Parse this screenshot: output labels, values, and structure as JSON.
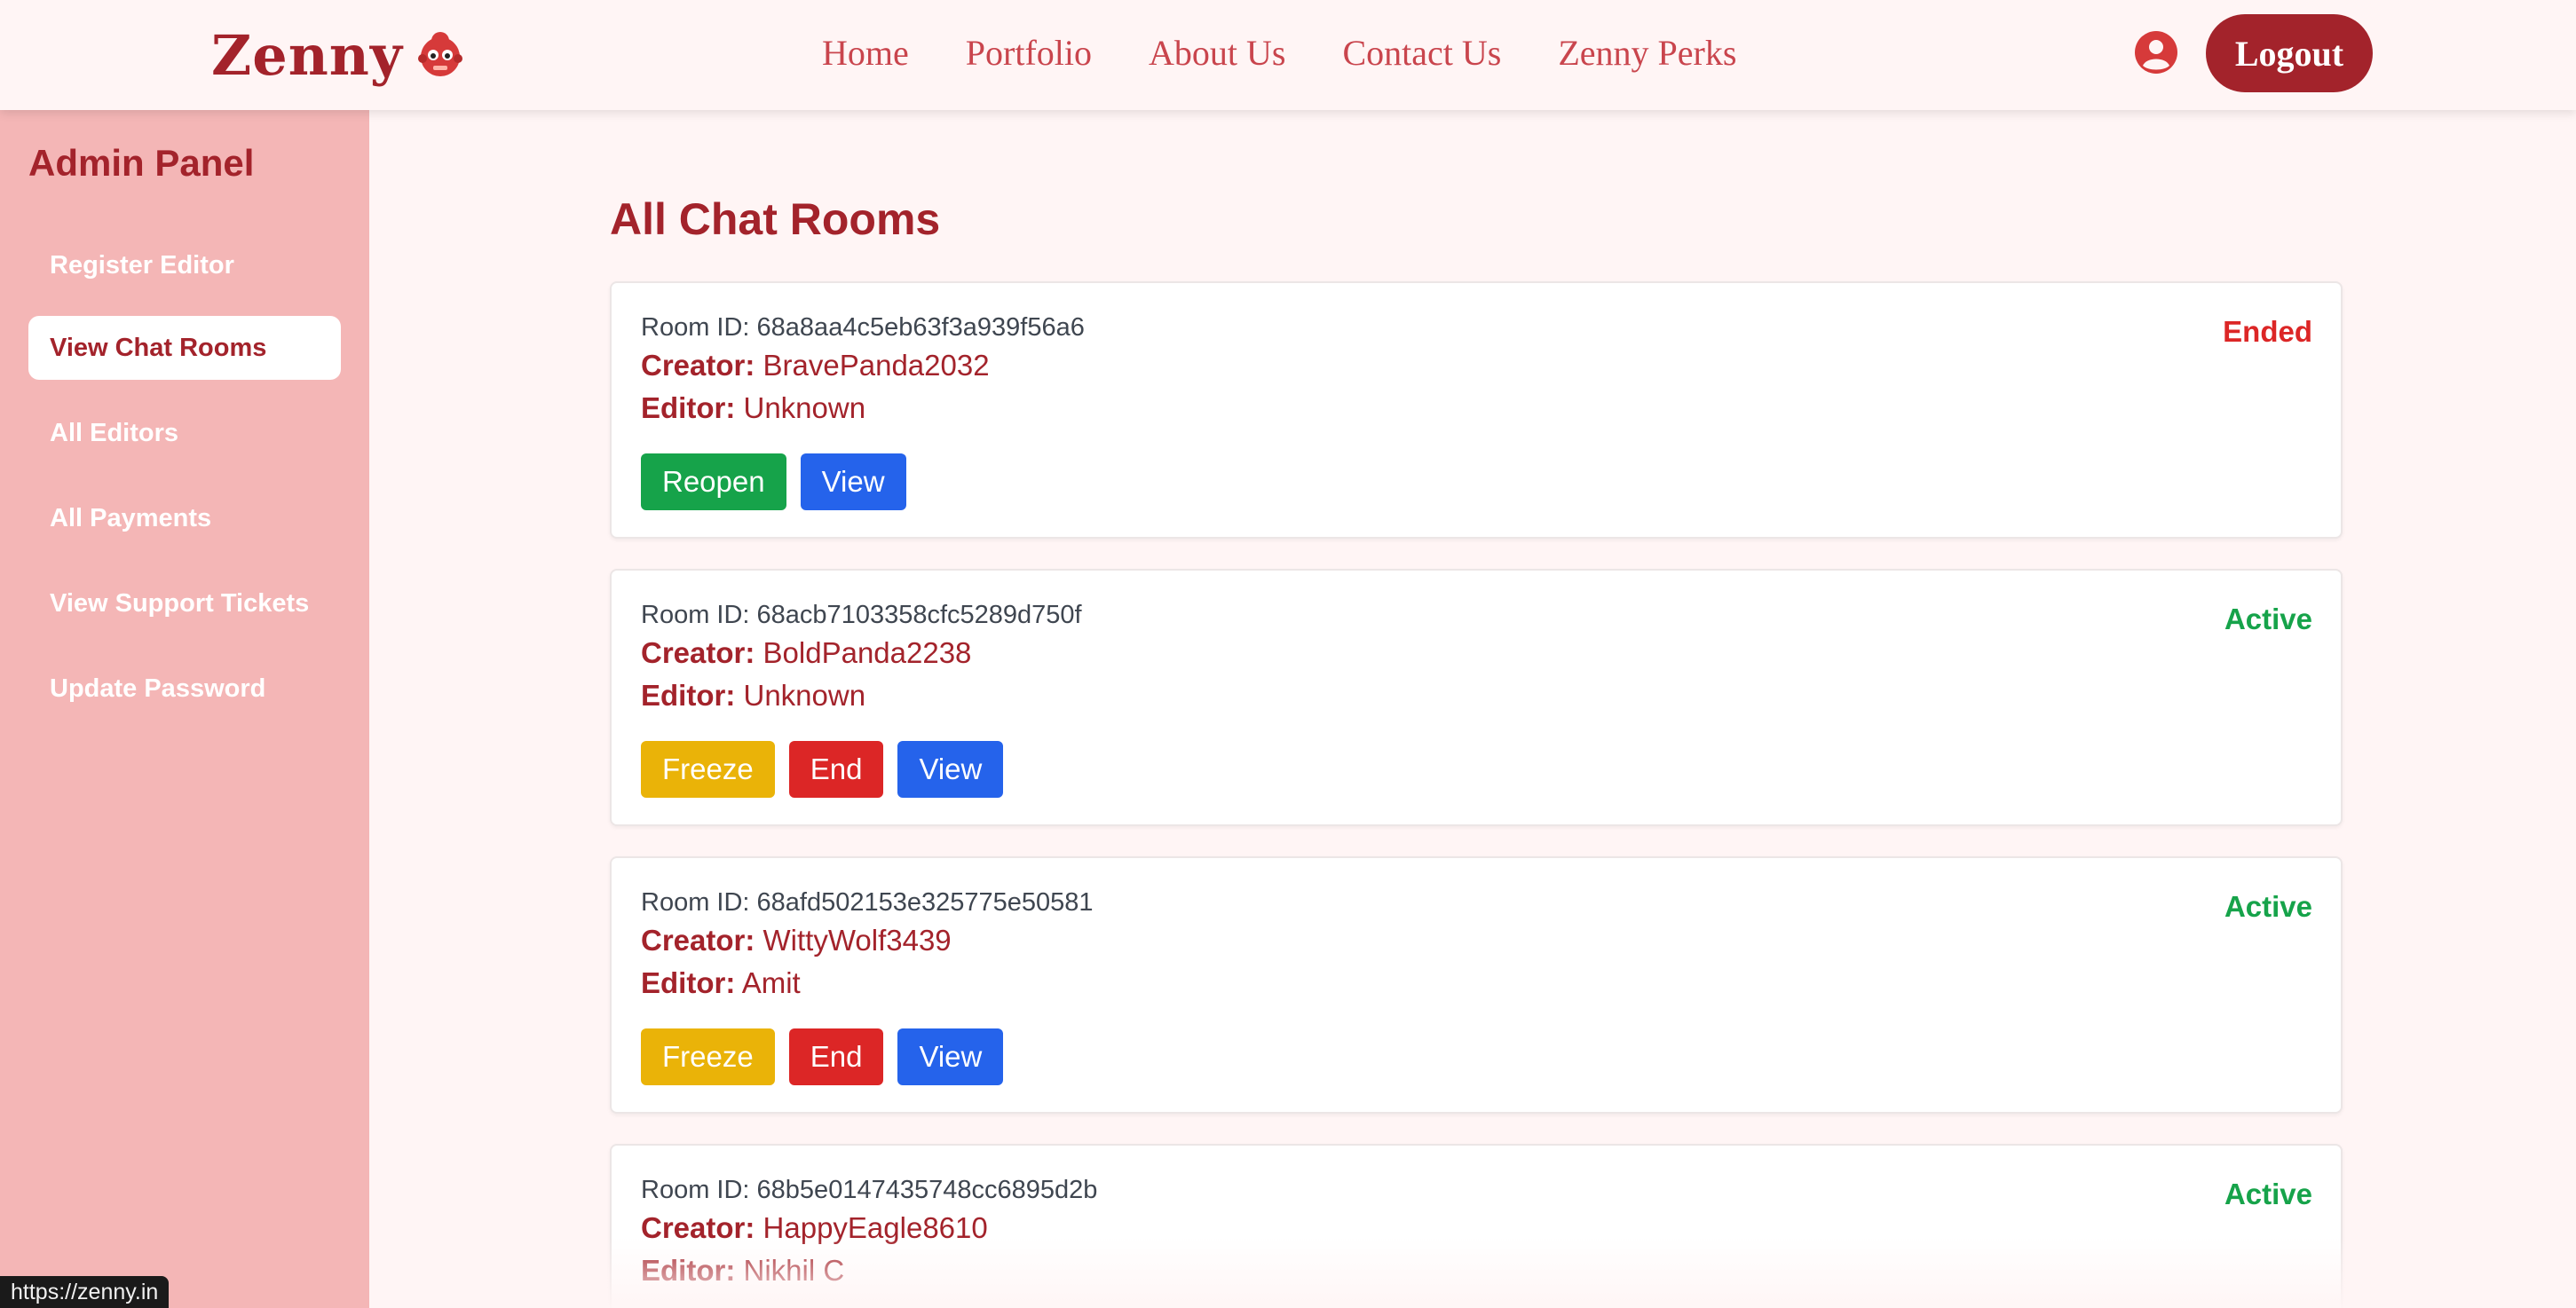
{
  "header": {
    "brand": "Zenny",
    "nav": [
      "Home",
      "Portfolio",
      "About Us",
      "Contact Us",
      "Zenny Perks"
    ],
    "logout_label": "Logout"
  },
  "sidebar": {
    "title": "Admin Panel",
    "items": [
      {
        "label": "Register Editor",
        "active": false
      },
      {
        "label": "View Chat Rooms",
        "active": true
      },
      {
        "label": "All Editors",
        "active": false
      },
      {
        "label": "All Payments",
        "active": false
      },
      {
        "label": "View Support Tickets",
        "active": false
      },
      {
        "label": "Update Password",
        "active": false
      }
    ]
  },
  "main": {
    "title": "All Chat Rooms",
    "labels": {
      "room_id": "Room ID:",
      "creator": "Creator:",
      "editor": "Editor:"
    },
    "rooms": [
      {
        "room_id": "68a8aa4c5eb63f3a939f56a6",
        "creator": "BravePanda2032",
        "editor": "Unknown",
        "status": "Ended",
        "actions": [
          "Reopen",
          "View"
        ]
      },
      {
        "room_id": "68acb7103358cfc5289d750f",
        "creator": "BoldPanda2238",
        "editor": "Unknown",
        "status": "Active",
        "actions": [
          "Freeze",
          "End",
          "View"
        ]
      },
      {
        "room_id": "68afd502153e325775e50581",
        "creator": "WittyWolf3439",
        "editor": "Amit",
        "status": "Active",
        "actions": [
          "Freeze",
          "End",
          "View"
        ]
      },
      {
        "room_id": "68b5e0147435748cc6895d2b",
        "creator": "HappyEagle8610",
        "editor": "Nikhil C",
        "status": "Active",
        "actions": []
      }
    ]
  },
  "status_bar": {
    "url": "https://zenny.in"
  },
  "colors": {
    "brand": "#a3232b",
    "sidebar": "#f4b6b6",
    "active_status": "#16a34a",
    "ended_status": "#dc2626",
    "reopen": "#16a34a",
    "view": "#2563eb",
    "freeze": "#eab308",
    "end": "#dc2626"
  },
  "icons": {
    "user": "user-circle-icon",
    "mascot": "mascot-logo"
  }
}
